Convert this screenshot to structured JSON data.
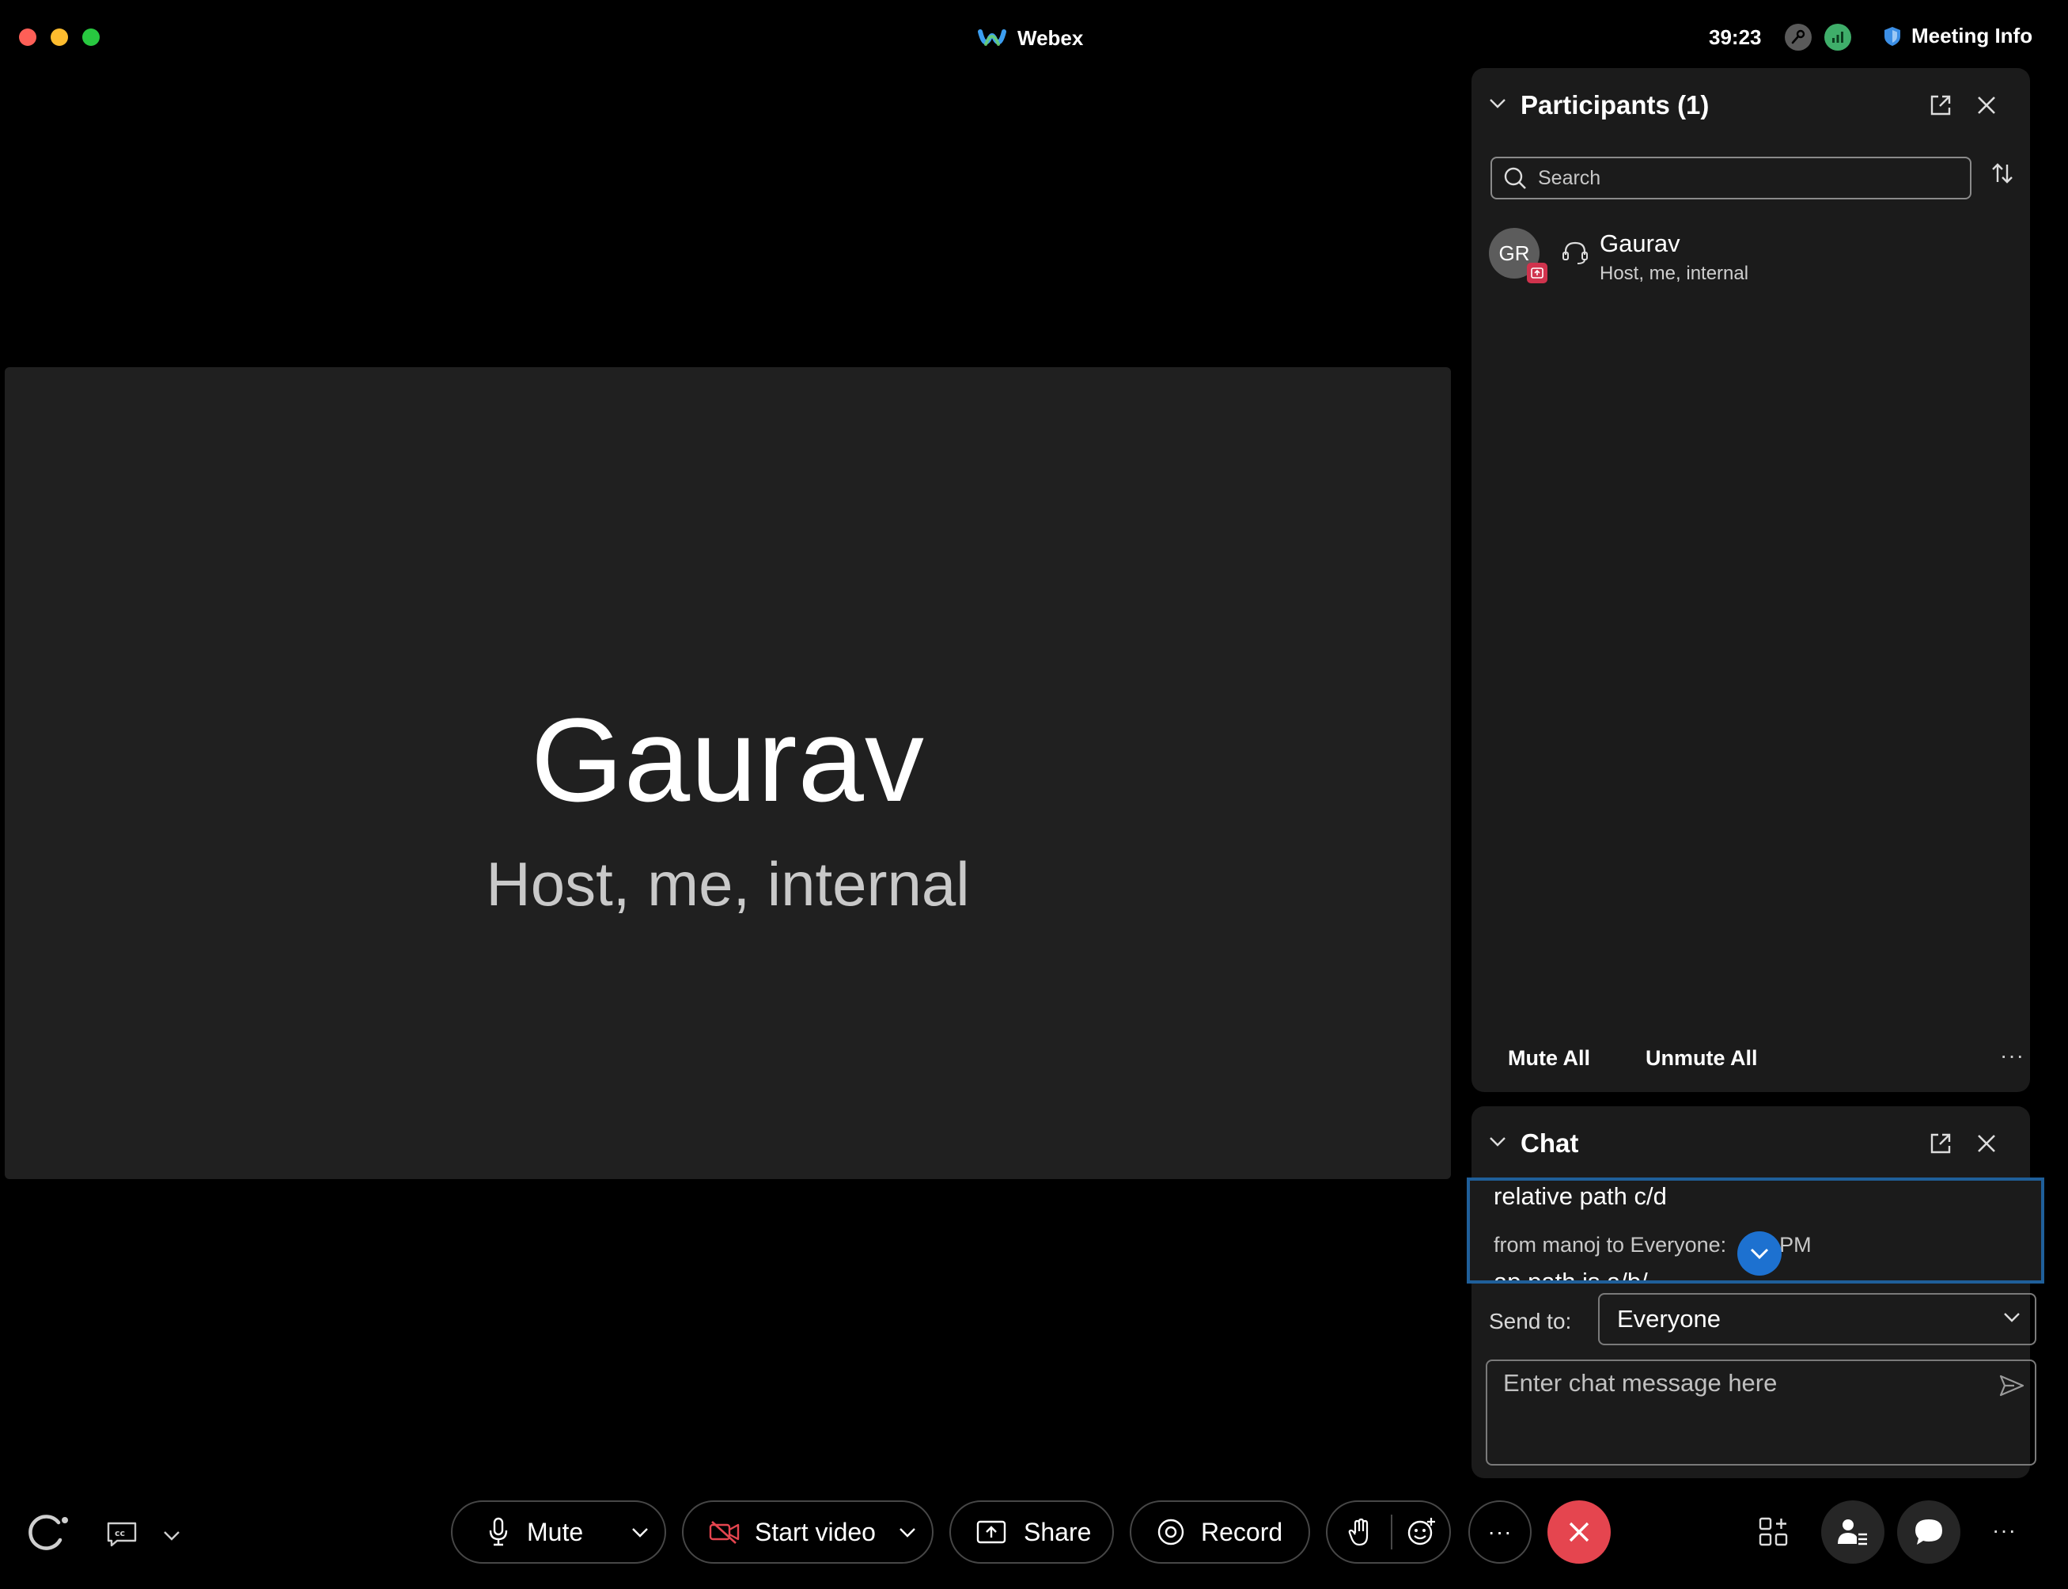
{
  "window": {
    "app_title": "Webex",
    "timer": "39:23",
    "meeting_info_label": "Meeting Info"
  },
  "stage": {
    "name": "Gaurav",
    "role": "Host, me, internal"
  },
  "participants": {
    "title": "Participants (1)",
    "search_placeholder": "Search",
    "list": [
      {
        "initials": "GR",
        "name": "Gaurav",
        "role": "Host, me, internal"
      }
    ],
    "mute_all": "Mute All",
    "unmute_all": "Unmute All",
    "more": "···"
  },
  "chat": {
    "title": "Chat",
    "messages": [
      {
        "text": "relative path c/d"
      },
      {
        "meta": "from manoj to Everyone:  ",
        "time": "23  PM",
        "text": "ap path is a/b/"
      }
    ],
    "send_to_label": "Send to:",
    "send_to_value": "Everyone",
    "input_placeholder": "Enter chat message here"
  },
  "toolbar": {
    "mute_label": "Mute",
    "video_label": "Start video",
    "share_label": "Share",
    "record_label": "Record",
    "more": "···",
    "overflow": "···"
  },
  "colors": {
    "end_call": "#e5454f",
    "accent_blue": "#1d71d0",
    "panel_bg": "#1b1b1b",
    "stage_bg": "#202020",
    "status_green": "#3fae6a"
  }
}
